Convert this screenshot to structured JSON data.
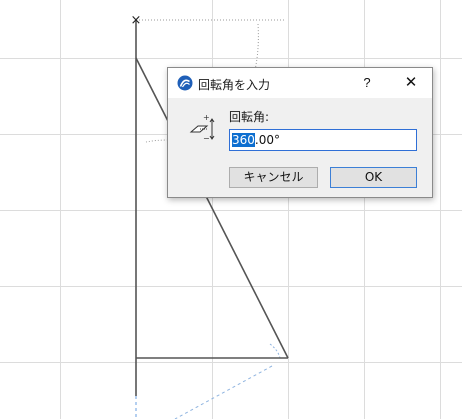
{
  "dialog": {
    "title": "回転角を入力",
    "help_label": "?",
    "close_label": "✕",
    "field_label": "回転角:",
    "angle_value_selected": "360",
    "angle_value_rest": ".00°",
    "cancel_label": "キャンセル",
    "ok_label": "OK"
  },
  "canvas": {
    "origin_marker": "×"
  },
  "colors": {
    "accent": "#0e6fd0",
    "focus_border": "#2f6fd6",
    "grid_line": "#dcdcdc",
    "shape_line": "#555555",
    "guide_line": "#8fb4e0"
  },
  "icons": [
    "archicad-app-icon",
    "rotate-angle-icon",
    "close-icon",
    "help-icon"
  ]
}
